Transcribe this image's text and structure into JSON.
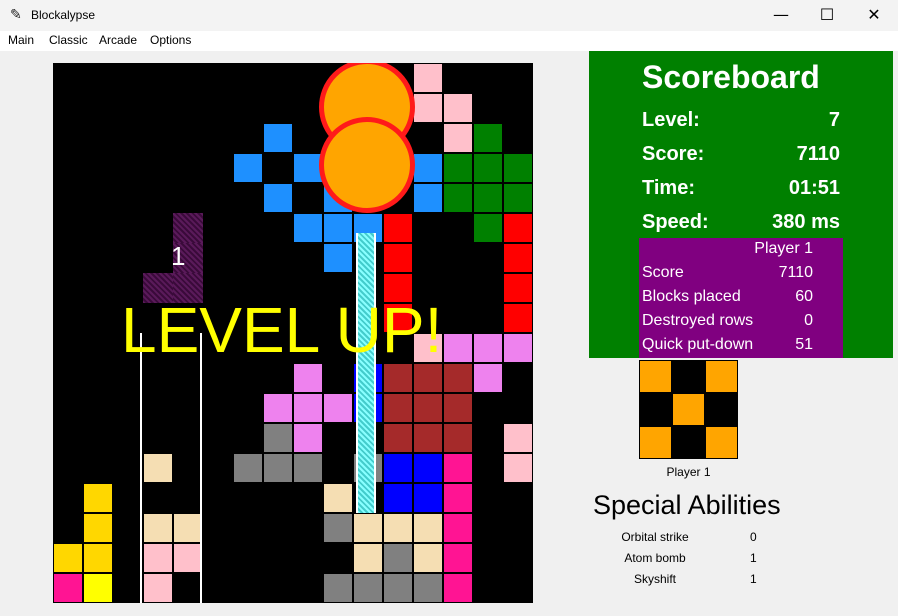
{
  "window": {
    "title": "Blockalypse",
    "minimize": "—",
    "maximize": "☐",
    "close": "✕"
  },
  "menu": [
    "Main",
    "Classic",
    "Arcade",
    "Options"
  ],
  "board": {
    "overlay_text": "LEVEL UP!",
    "countdown": "1"
  },
  "scoreboard": {
    "title": "Scoreboard",
    "rows": [
      {
        "label": "Level:",
        "value": "7"
      },
      {
        "label": "Score:",
        "value": "7110"
      },
      {
        "label": "Time:",
        "value": "01:51"
      },
      {
        "label": "Speed:",
        "value": "380 ms"
      }
    ],
    "player_header": "Player 1",
    "stats": [
      {
        "name": "Score",
        "value": "7110"
      },
      {
        "name": "Blocks placed",
        "value": "60"
      },
      {
        "name": "Destroyed rows",
        "value": "0"
      },
      {
        "name": "Quick put-down",
        "value": "51"
      }
    ]
  },
  "preview": {
    "label": "Player 1"
  },
  "abilities": {
    "title": "Special Abilities",
    "items": [
      {
        "name": "Orbital strike",
        "count": "0"
      },
      {
        "name": "Atom bomb",
        "count": "1"
      },
      {
        "name": "Skyshift",
        "count": "1"
      }
    ]
  },
  "colors": {
    "blue": "#1e90ff",
    "red": "#ff0000",
    "green": "#008000",
    "pink": "#ffc0cb",
    "violet": "#ee82ee",
    "brown": "#a52a2a",
    "gray": "#808080",
    "wheat": "#f5deb3",
    "deeppink": "#ff1493",
    "gold": "#ffd700",
    "yellow": "#ffff00",
    "orange": "#ffa500",
    "royal": "#0000ff",
    "scoreboard": "#008000",
    "stats": "#800080",
    "overlay": "#ffff00"
  }
}
